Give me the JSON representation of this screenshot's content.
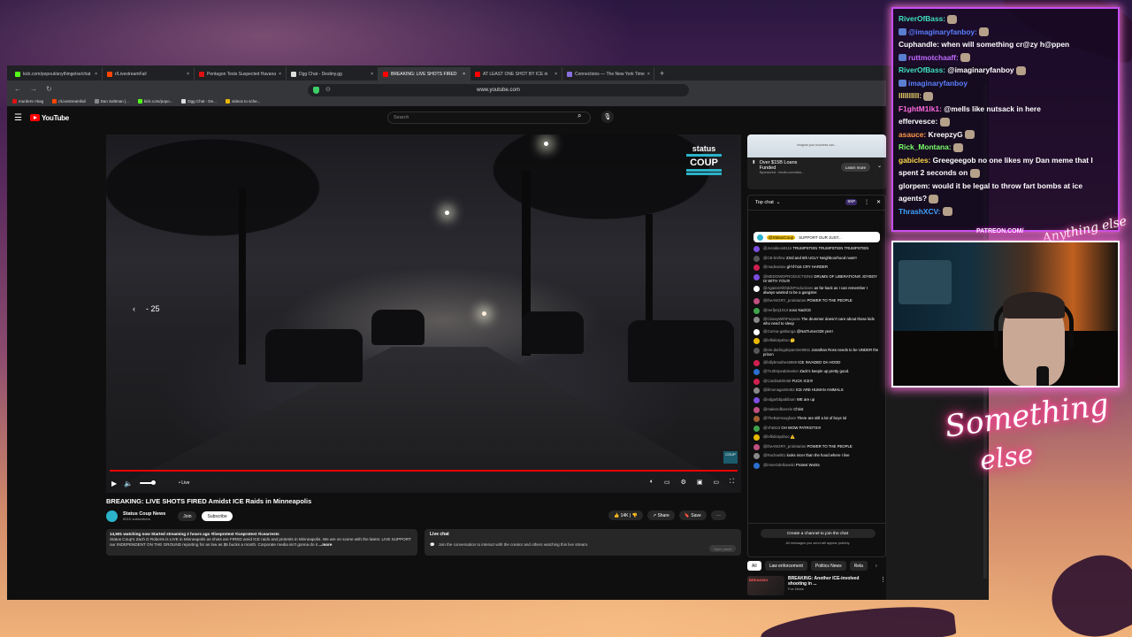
{
  "browser": {
    "tabs": [
      {
        "label": "kick.com/popout/anythingelse/chat",
        "color": "#53fc18",
        "active": false
      },
      {
        "label": "r/LivestreamFail",
        "color": "#ff4500",
        "active": false
      },
      {
        "label": "Pentagon Tests Suspected Havana",
        "color": "#d11",
        "active": false
      },
      {
        "label": "Dgg Chat - Destiny.gg",
        "color": "#ddd",
        "active": false
      },
      {
        "label": "BREAKING: LIVE SHOTS FIRED",
        "color": "#f00",
        "active": true
      },
      {
        "label": "AT LEAST ONE SHOT BY ICE in",
        "color": "#f00",
        "active": false
      },
      {
        "label": "Connections — The New York Time",
        "color": "#8a6fdf",
        "active": false
      }
    ],
    "new_tab": "+",
    "url": "www.youtube.com",
    "bookmarks": [
      {
        "label": "murders->bag",
        "color": "#d11"
      },
      {
        "label": "r/Livestreamfail",
        "color": "#ff4500"
      },
      {
        "label": "Dan Saltman |...",
        "color": "#888"
      },
      {
        "label": "kick.com/popo...",
        "color": "#53fc18"
      },
      {
        "label": "Dgg Chat - De...",
        "color": "#ddd"
      },
      {
        "label": "videos to sche...",
        "color": "#e8b800"
      }
    ]
  },
  "youtube": {
    "logo": "YouTube",
    "search_placeholder": "Search",
    "video": {
      "seek_label": "- 25",
      "live_label": "• Live",
      "brand_top": "status",
      "brand_bottom": "COUP"
    },
    "title": "BREAKING: LIVE SHOTS FIRED Amidst ICE Raids in Minneapolis",
    "channel": {
      "name": "Status Coup News",
      "subs": "691K subscribers",
      "join": "Join",
      "subscribe": "Subscribe"
    },
    "actions": {
      "likes": "14K",
      "share": "Share",
      "save": "Save"
    },
    "description": {
      "stats": "14,591 watching now  Started streaming 2 hours ago  #liveprotest #iceprotest #icearrests",
      "body": "Status Coup's Zach D Roberts is LIVE in Minneapolis as shots are FIRED amid ICE raids and protests in Minneapolis. We are on scene with the latest. LIVE SUPPORT our INDEPENDENT ON THE GROUND reporting for as low as $5 bucks a month. Corporate media isn't gonna do it",
      "more": "...more"
    },
    "live_chat_box": {
      "title": "Live chat",
      "body": "Join the conversation to interact with the creator and others watching this live stream.",
      "button": "Open panel"
    },
    "ad": {
      "banner": "Imagine your business can...",
      "title_line1": "Over $15B Loans",
      "title_line2": "Funded",
      "sponsor": "Sponsored · lendio.com/sba...",
      "cta": "Learn more"
    },
    "chat": {
      "header": "Top chat",
      "points": "9XP",
      "pinned_tag": "@StatusCoup",
      "pinned_text": "SUPPORT OUR JUST...",
      "messages": [
        {
          "user": "@Jeraldeos8116",
          "text": "TRUMPSTIEN TRUMPSTIEN TRUMPSTIEN",
          "color": "#7b4de0"
        },
        {
          "user": "@CB-bnthrw",
          "text": "23rd and 6th UGLY Neighboorhood now!!!",
          "color": "#555"
        },
        {
          "user": "@madeastox",
          "text": "gl-hf-h16 CRY HARDER",
          "color": "#d02050"
        },
        {
          "user": "@MEDOWDPRODUCTIONS",
          "text": "DRUMS OF LIBERATION!!! JOYBOY IS WITH YOU!!!",
          "color": "#7b4de0"
        },
        {
          "user": "@AgainstAllOddsProductions",
          "text": "as far back as I can remember I always wanted to be a gangster.",
          "color": "#fff"
        },
        {
          "user": "@theANGRY_proletarian",
          "text": "POWER TO THE PEOPLE",
          "color": "#c05080"
        },
        {
          "user": "@reefjenj1013",
          "text": "xoxo NaziCE",
          "color": "#3fa34d"
        },
        {
          "user": "@ClassyWithPurpose",
          "text": "The drummer doesn't care about those kids who need to sleep",
          "color": "#888"
        },
        {
          "user": "@Gonna-gatbanga",
          "text": "@NatTurner328 yes!!",
          "color": "#fff"
        },
        {
          "user": "@leftidiotyahoo",
          "text": "🤔",
          "color": "#e8b800"
        },
        {
          "user": "@ere.darlingdopamine9551",
          "text": "Jonathan Ross needs to be UNDER the prison",
          "color": "#555"
        },
        {
          "user": "@billybreathes8888",
          "text": "ICE INVADED DA HOOD",
          "color": "#d02050"
        },
        {
          "user": "@TruthSpeakSeeker",
          "text": "Zack's keepin up pretty good.",
          "color": "#2a6fd0"
        },
        {
          "user": "@CardinalSin69",
          "text": "FUCK ICE!!!",
          "color": "#d02050"
        },
        {
          "user": "@illmenagain5452",
          "text": "ICE ARE HUMAN ANIMALS",
          "color": "#888"
        },
        {
          "user": "@edgarbbpabibum",
          "text": "WE are up",
          "color": "#7b4de0"
        },
        {
          "user": "@makerofbarrels",
          "text": "Christ",
          "color": "#c05080"
        },
        {
          "user": "@TheBarHougham",
          "text": "There are still a lot of boys lol",
          "color": "#a06030"
        },
        {
          "user": "@Vh9323",
          "text": "OH WOW PATRIOTS!!!",
          "color": "#3fa34d"
        },
        {
          "user": "@leftidiotyahoo",
          "text": "⚠️",
          "color": "#e8b800"
        },
        {
          "user": "@theANGRY_proletarian",
          "text": "POWER TO THE PEOPLE",
          "color": "#c05080"
        },
        {
          "user": "@RachaelB1",
          "text": "looks nicer than the hood where I live",
          "color": "#888"
        },
        {
          "user": "@imneOdelkowski",
          "text": "Protest Works",
          "color": "#2a6fd0"
        }
      ],
      "create_channel": "Create a channel to join the chat",
      "note": "All messages you send will appear publicly"
    },
    "chips": [
      "All",
      "Law enforcement",
      "Politics News",
      "Rela"
    ],
    "rec": {
      "thumb_label": "BREAKING",
      "title": "BREAKING: Another ICE-involved shooting in ...",
      "source": "Fox News"
    }
  },
  "stream_chat": [
    {
      "user": "RiverOfBass:",
      "text": "",
      "ucolor": "#3fe0c0",
      "badge": false,
      "emote": true
    },
    {
      "user": "@imaginaryfanboy:",
      "text": "",
      "ucolor": "#5a7fff",
      "badge": true,
      "emote": true
    },
    {
      "user": "Cuphandle:",
      "text": "when will something cr@zy h@ppen",
      "ucolor": "#ffffff",
      "badge": false,
      "emote": false
    },
    {
      "user": "ruttmotchaaff:",
      "text": "",
      "ucolor": "#c06aff",
      "badge": true,
      "emote": true
    },
    {
      "user": "RiverOfBass:",
      "text": "@imaginaryfanboy",
      "ucolor": "#3fe0c0",
      "badge": false,
      "emote": true
    },
    {
      "user": "imaginaryfanboy",
      "text": "",
      "ucolor": "#5a7fff",
      "badge": true,
      "emote": false
    },
    {
      "user": "IIIIIIIIII:",
      "text": "",
      "ucolor": "#e8d06a",
      "badge": false,
      "emote": true
    },
    {
      "user": "F1ghtM1lk1:",
      "text": "@mells like nutsack in here",
      "ucolor": "#ff6ae0",
      "badge": false,
      "emote": false
    },
    {
      "user": "effervesce:",
      "text": "",
      "ucolor": "#ffffff",
      "badge": false,
      "emote": true
    },
    {
      "user": "asauce:",
      "text": "KreepzyG",
      "ucolor": "#ff9a4a",
      "badge": false,
      "emote": true
    },
    {
      "user": "Rick_Montana:",
      "text": "",
      "ucolor": "#7aff6a",
      "badge": false,
      "emote": true
    },
    {
      "user": "gabicles:",
      "text": "Greegeegob no one likes my Dan meme that I",
      "ucolor": "#ffd84a",
      "badge": false,
      "emote": false
    },
    {
      "user": "",
      "text": "spent 2 seconds on",
      "ucolor": "#ffffff",
      "badge": false,
      "emote": true
    },
    {
      "user": "glorpem:",
      "text": "would it be legal to throw fart bombs at ice",
      "ucolor": "#ffffff",
      "badge": false,
      "emote": false
    },
    {
      "user": "",
      "text": "agents?",
      "ucolor": "#ffffff",
      "badge": false,
      "emote": true
    },
    {
      "user": "ThrashXCV:",
      "text": "",
      "ucolor": "#3fa3ff",
      "badge": false,
      "emote": true
    }
  ],
  "overlay": {
    "patreon": "PATREON.COM/",
    "signature_small": "Anything else",
    "signature_line1": "Something",
    "signature_line2": "else"
  },
  "colors": {
    "accent": "#ff0000",
    "overlay_border": "#c44ff0",
    "glow": "#ff6ad8"
  }
}
